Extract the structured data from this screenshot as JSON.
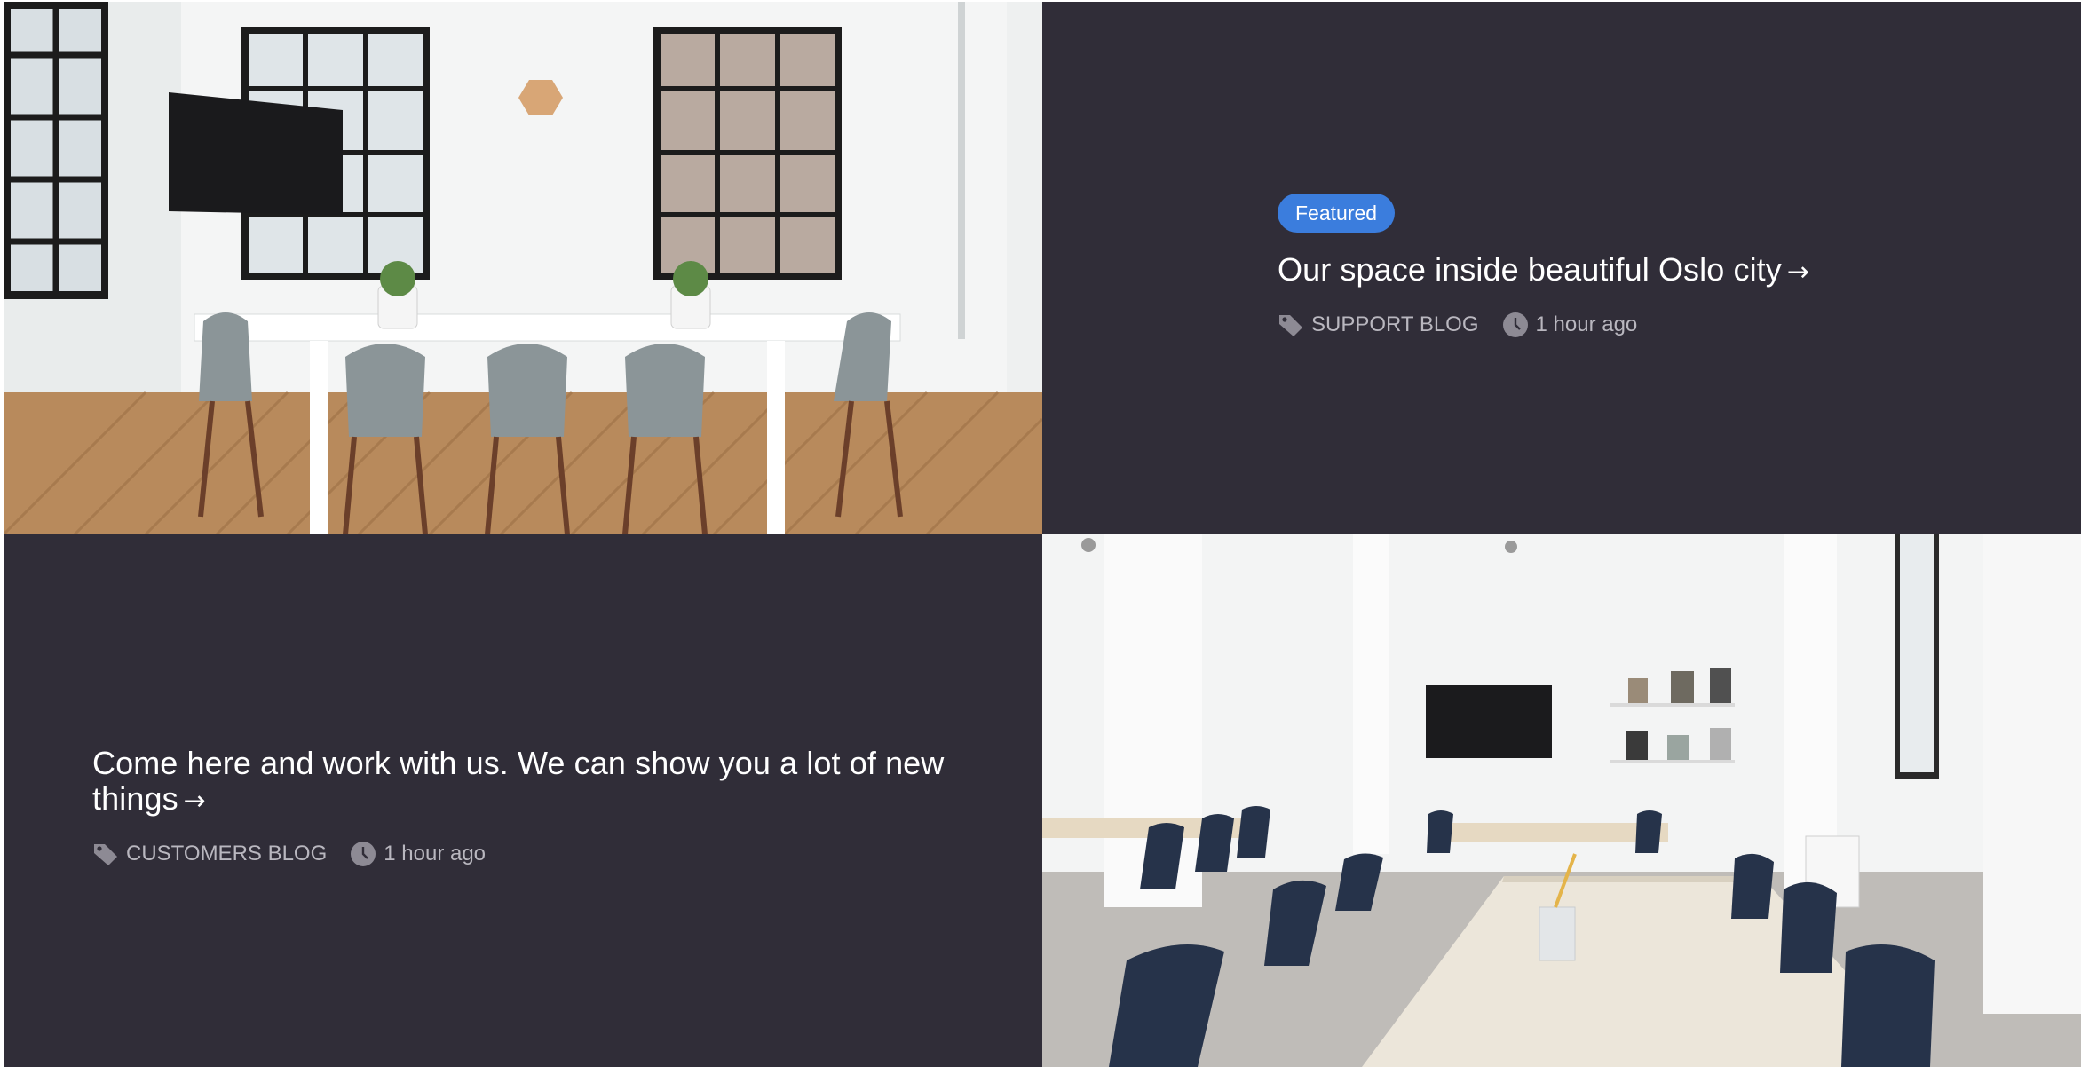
{
  "posts": [
    {
      "badge": "Featured",
      "title": "Our space inside beautiful Oslo city",
      "arrow": "→",
      "category": "SUPPORT BLOG",
      "time": "1 hour ago"
    },
    {
      "title": "Come here and work with us. We can show you a lot of new things",
      "arrow": "→",
      "category": "CUSTOMERS BLOG",
      "time": "1 hour ago"
    }
  ],
  "colors": {
    "card_background": "#302d38",
    "badge_background": "#3b7ddd",
    "meta_text": "#b9b7bf"
  },
  "icons": [
    "tag-icon",
    "clock-icon"
  ]
}
